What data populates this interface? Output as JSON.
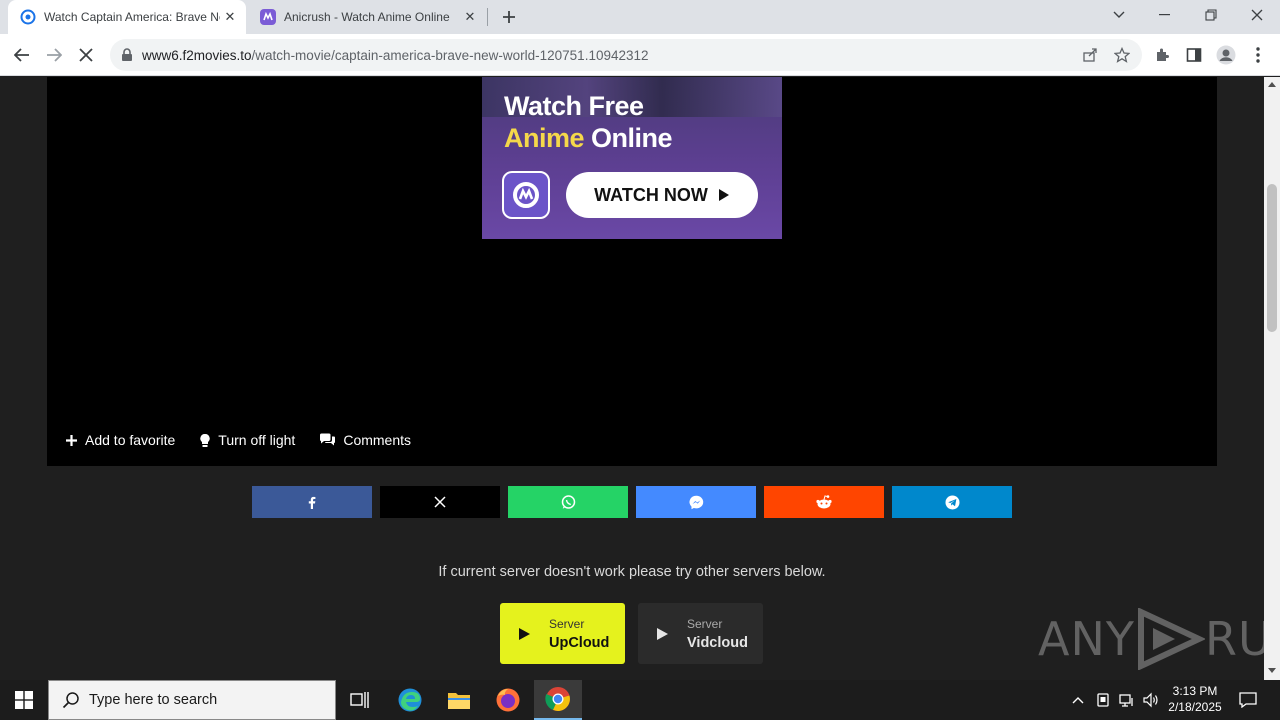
{
  "browser": {
    "tabs": [
      {
        "title": "Watch Captain America: Brave New World",
        "active": true
      },
      {
        "title": "Anicrush - Watch Anime Online",
        "active": false
      }
    ],
    "new_tab": "+",
    "url_host": "www6.f2movies.to",
    "url_path": "/watch-movie/captain-america-brave-new-world-120751.10942312"
  },
  "ad": {
    "line1": "Watch Free",
    "line2_accent": "Anime",
    "line2_rest": "Online",
    "cta": "WATCH NOW"
  },
  "player_actions": {
    "favorite": "Add to favorite",
    "light": "Turn off light",
    "comments": "Comments"
  },
  "share": {
    "colors": {
      "facebook": "#3b5998",
      "x": "#000000",
      "whatsapp": "#25d366",
      "messenger": "#448aff",
      "reddit": "#ff4500",
      "telegram": "#0088cc"
    }
  },
  "notice": "If current server doesn't work please try other servers below.",
  "servers": [
    {
      "label": "Server",
      "name": "UpCloud",
      "active": true
    },
    {
      "label": "Server",
      "name": "Vidcloud",
      "active": false
    }
  ],
  "watermark": {
    "left": "ANY",
    "right": "RUN"
  },
  "taskbar": {
    "search_placeholder": "Type here to search",
    "time": "3:13 PM",
    "date": "2/18/2025"
  }
}
